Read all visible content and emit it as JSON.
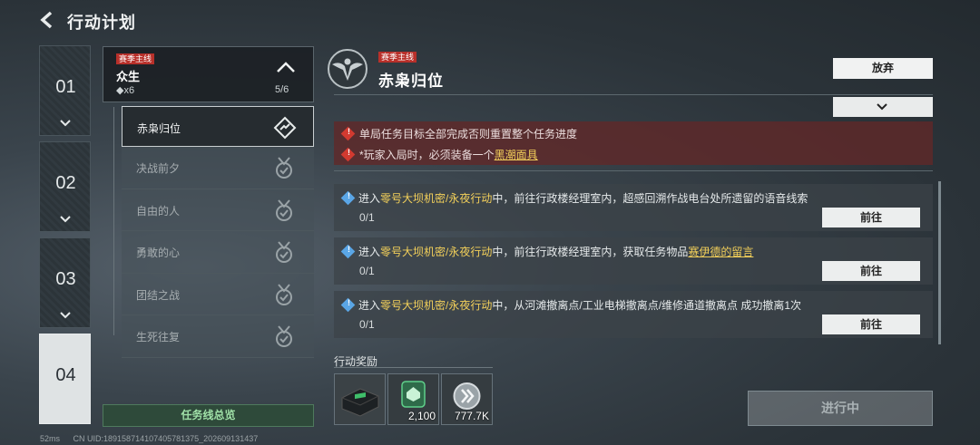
{
  "header": {
    "title": "行动计划"
  },
  "chapters": [
    {
      "number": "01"
    },
    {
      "number": "02"
    },
    {
      "number": "03"
    },
    {
      "number": "04"
    }
  ],
  "quest_line": {
    "tag": "赛季主线",
    "name": "众生",
    "count": "◆x6",
    "progress": "5/6"
  },
  "missions": [
    {
      "label": "赤枭归位"
    },
    {
      "label": "决战前夕"
    },
    {
      "label": "自由的人"
    },
    {
      "label": "勇敢的心"
    },
    {
      "label": "团结之战"
    },
    {
      "label": "生死往复"
    }
  ],
  "overview_button": "任务线总览",
  "detail": {
    "tag": "赛季主线",
    "title": "赤枭归位",
    "abandon_label": "放弃",
    "warnings": {
      "line1": "单局任务目标全部完成否则重置整个任务进度",
      "line2_prefix": "*玩家入局时，必须装备一个",
      "line2_item": "黑潮面具"
    },
    "tasks": [
      {
        "prefix": "进入",
        "location": "零号大坝机密/永夜行动",
        "text": "中，前往行政楼经理室内，超感回溯作战电台处所遗留的语音线索",
        "item": "",
        "progress": "0/1",
        "button": "前往"
      },
      {
        "prefix": "进入",
        "location": "零号大坝机密/永夜行动",
        "text": "中，前往行政楼经理室内，获取任务物品",
        "item": "赛伊德的留言",
        "progress": "0/1",
        "button": "前往"
      },
      {
        "prefix": "进入",
        "location": "零号大坝机密/永夜行动",
        "text": "中，从河滩撤离点/工业电梯撤离点/维修通道撤离点 成功撤离1次",
        "item": "",
        "progress": "0/1",
        "button": "前往"
      }
    ]
  },
  "rewards": {
    "label": "行动奖励",
    "items": [
      {
        "icon": "supply-box-icon",
        "qty": ""
      },
      {
        "icon": "badge-token-icon",
        "qty": "2,100"
      },
      {
        "icon": "silver-coin-icon",
        "qty": "777.7K"
      }
    ]
  },
  "status_button": "进行中",
  "footer": {
    "ping": "52ms",
    "uid": "CN UID:18915871410740578137​5_20260913143​7"
  },
  "colors": {
    "accent_yellow": "#f3d05a",
    "tag_red": "#b8302a",
    "warning_bg": "#622828",
    "overview_green": "#9fe0a7"
  }
}
